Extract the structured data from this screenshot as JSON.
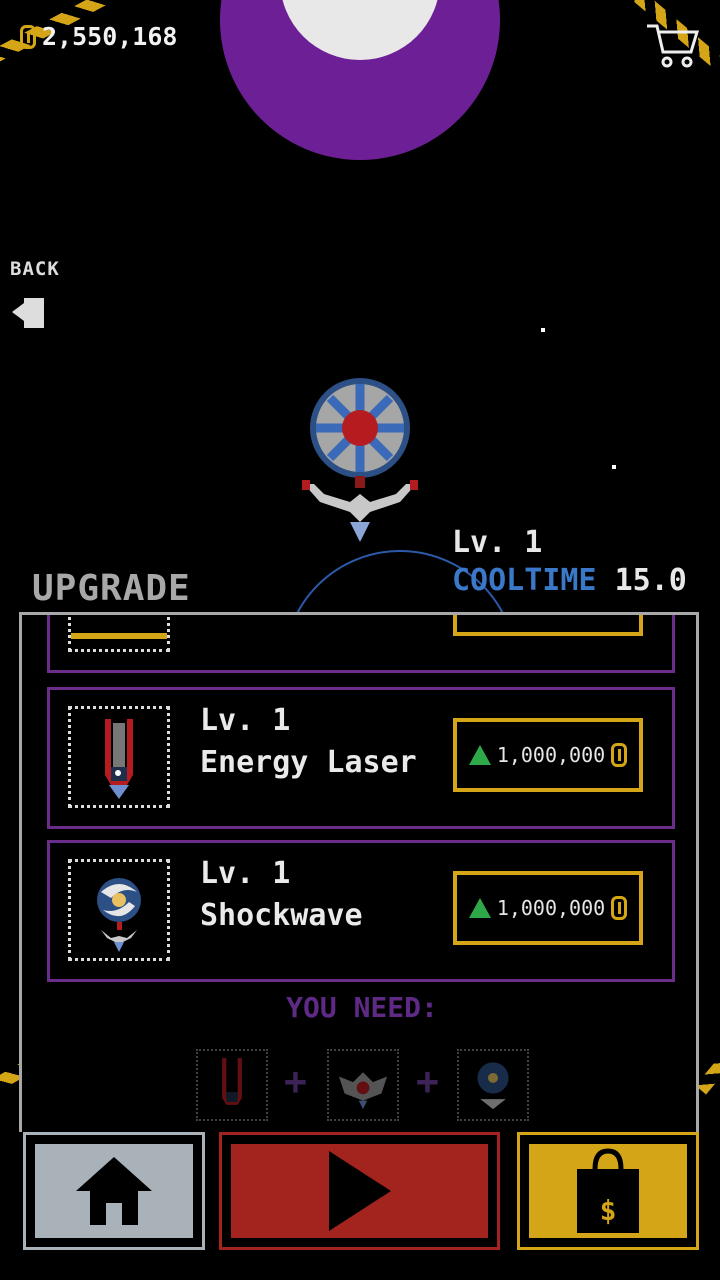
{
  "header": {
    "coins": "2,550,168",
    "coin_icon": "coin-icon",
    "cart_icon": "cart-icon"
  },
  "back": {
    "label": "BACK",
    "icon": "arrow-left-icon"
  },
  "upgrade": {
    "title": "UPGRADE",
    "level": "Lv. 1",
    "cooltime_label": "COOLTIME",
    "cooltime_value": "15.0"
  },
  "cards": [
    {
      "level": "Lv. 1",
      "name": "Energy Laser",
      "price": "1,000,000",
      "icon": "energy-laser-icon"
    },
    {
      "level": "Lv. 1",
      "name": "Shockwave",
      "price": "1,000,000",
      "icon": "shockwave-icon"
    }
  ],
  "requirements": {
    "title": "YOU NEED:",
    "items": [
      "energy-laser-icon",
      "turret-icon",
      "shockwave-icon"
    ],
    "separator": "+"
  },
  "nav": {
    "home_icon": "home-icon",
    "play_icon": "play-icon",
    "shop_icon": "shop-bag-icon",
    "shop_symbol": "$"
  },
  "colors": {
    "accent_gold": "#d4a516",
    "card_border": "#6b2d8a",
    "cooltime_blue": "#3a78c9",
    "home_btn": "#a9b1b9",
    "play_btn": "#a3241f",
    "shop_btn": "#d4a516",
    "price_arrow": "#2fa84a",
    "planet_ring": "#6d2096"
  }
}
